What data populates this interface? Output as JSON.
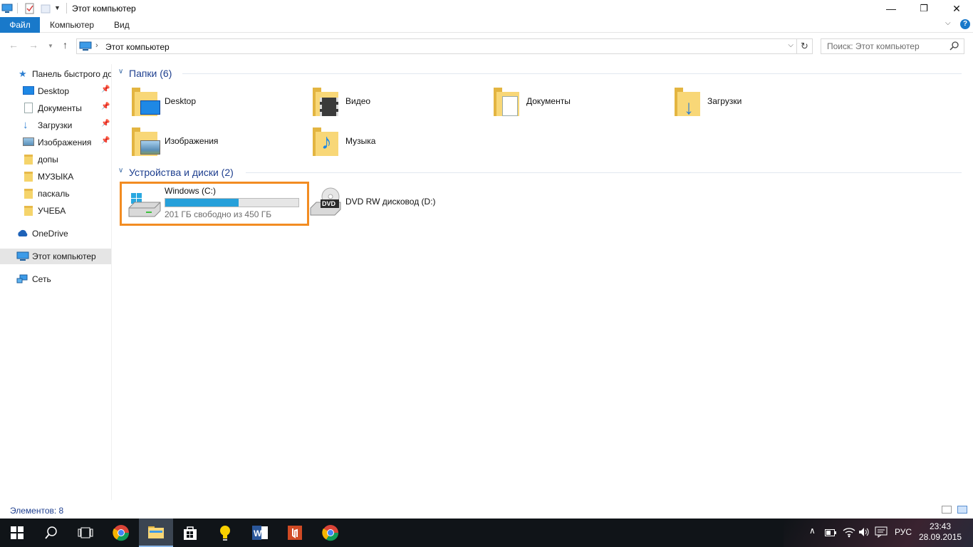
{
  "window": {
    "title": "Этот компьютер",
    "controls": {
      "minimize": "—",
      "maximize": "❐",
      "close": "✕"
    }
  },
  "ribbon": {
    "tabs": [
      {
        "label": "Файл"
      },
      {
        "label": "Компьютер"
      },
      {
        "label": "Вид"
      }
    ],
    "help": "?"
  },
  "address": {
    "path": "Этот компьютер",
    "search_placeholder": "Поиск: Этот компьютер"
  },
  "sidebar": {
    "quick_access": "Панель быстрого доступа",
    "items": [
      {
        "label": "Desktop",
        "pinned": true
      },
      {
        "label": "Документы",
        "pinned": true
      },
      {
        "label": "Загрузки",
        "pinned": true
      },
      {
        "label": "Изображения",
        "pinned": true
      },
      {
        "label": "допы",
        "pinned": false
      },
      {
        "label": "МУЗЫКА",
        "pinned": false
      },
      {
        "label": "паскаль",
        "pinned": false
      },
      {
        "label": "УЧЕБА",
        "pinned": false
      }
    ],
    "onedrive": "OneDrive",
    "this_pc": "Этот компьютер",
    "network": "Сеть"
  },
  "folders_group": {
    "title": "Папки (6)",
    "folders": [
      {
        "label": "Desktop"
      },
      {
        "label": "Видео"
      },
      {
        "label": "Документы"
      },
      {
        "label": "Загрузки"
      },
      {
        "label": "Изображения"
      },
      {
        "label": "Музыка"
      }
    ]
  },
  "devices_group": {
    "title": "Устройства и диски (2)",
    "drive_c": {
      "label": "Windows (C:)",
      "free_text": "201 ГБ свободно из 450 ГБ",
      "used_fraction": 0.553
    },
    "drive_d": {
      "label": "DVD RW дисковод (D:)",
      "badge": "DVD"
    }
  },
  "status": {
    "items_count": "Элементов: 8"
  },
  "taskbar": {
    "language": "РУС",
    "time": "23:43",
    "date": "28.09.2015"
  },
  "colors": {
    "accent": "#1979ca",
    "highlight": "#f28c22",
    "progress": "#26a0da"
  }
}
